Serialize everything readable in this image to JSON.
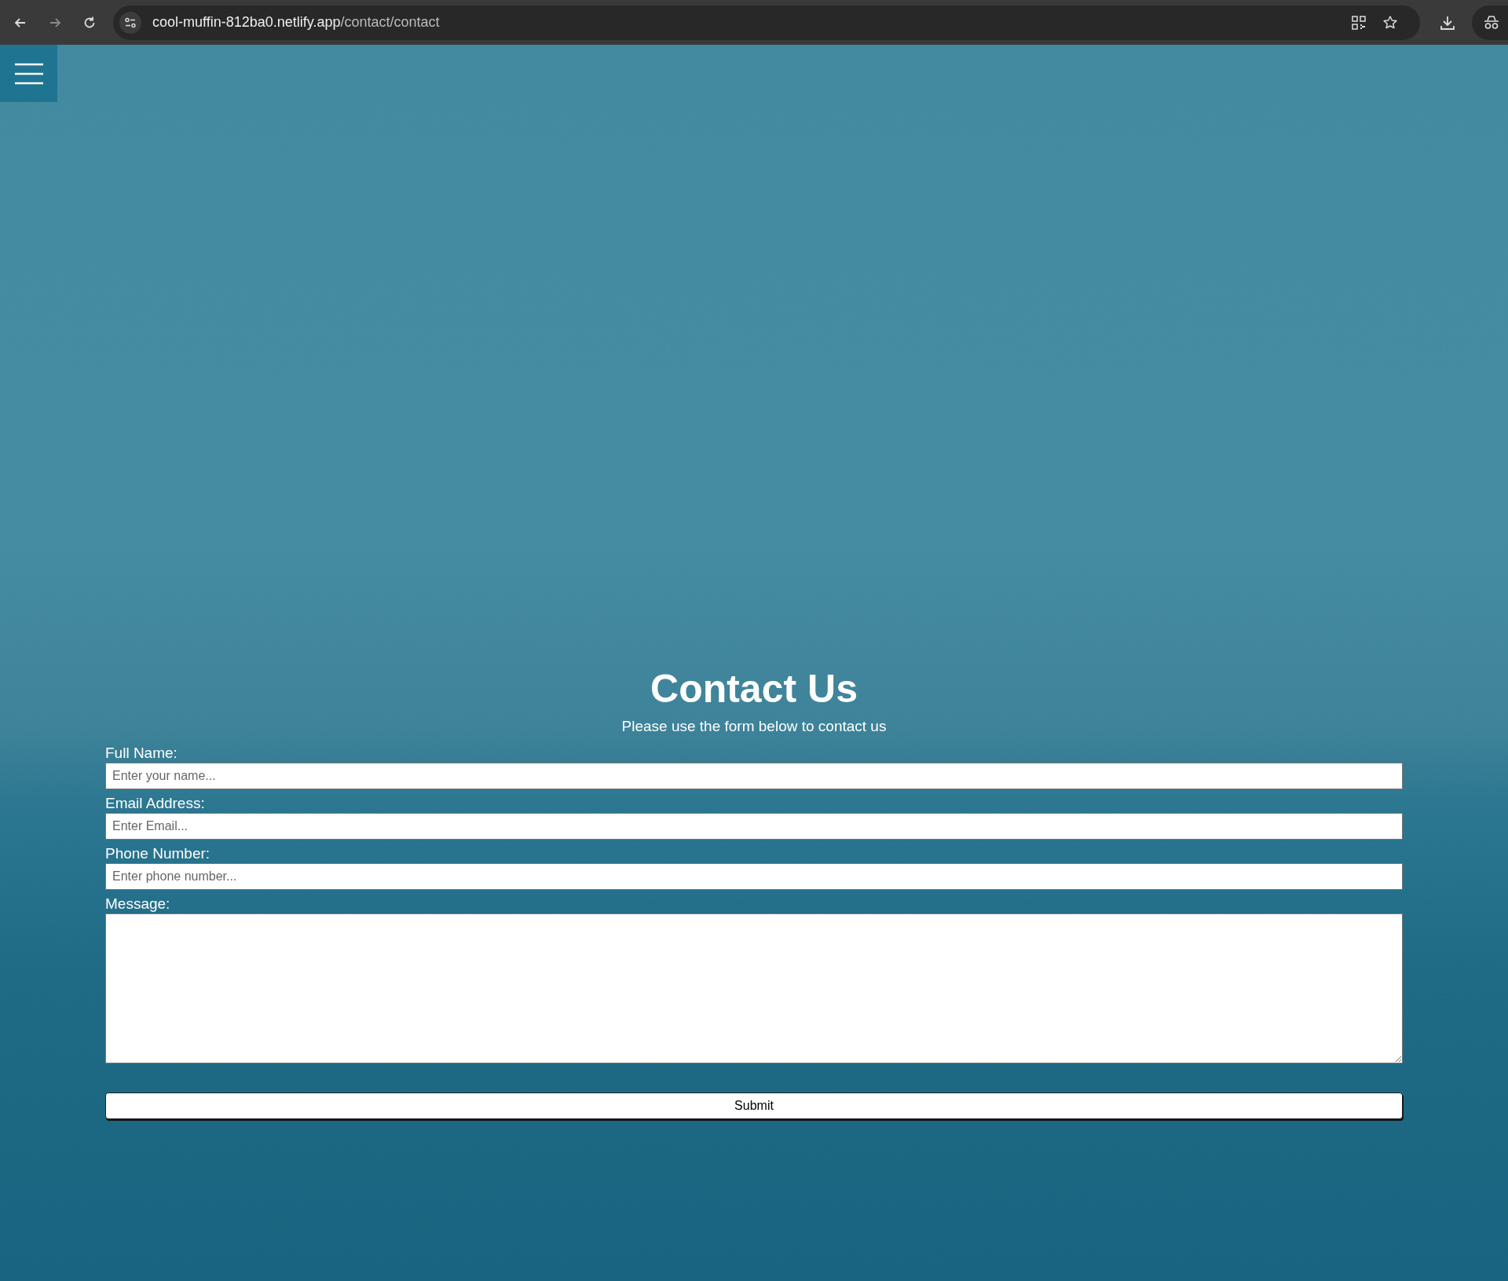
{
  "browser": {
    "url_host": "cool-muffin-812ba0.netlify.app",
    "url_path": "/contact/contact"
  },
  "contact": {
    "title": "Contact Us",
    "subtitle": "Please use the form below to contact us",
    "fields": [
      {
        "kind": "input",
        "label": "Full Name:",
        "placeholder": "Enter your name..."
      },
      {
        "kind": "input",
        "label": "Email Address:",
        "placeholder": "Enter Email..."
      },
      {
        "kind": "input",
        "label": "Phone Number:",
        "placeholder": "Enter phone number..."
      },
      {
        "kind": "textarea",
        "label": "Message:"
      }
    ],
    "submit": "Submit"
  }
}
